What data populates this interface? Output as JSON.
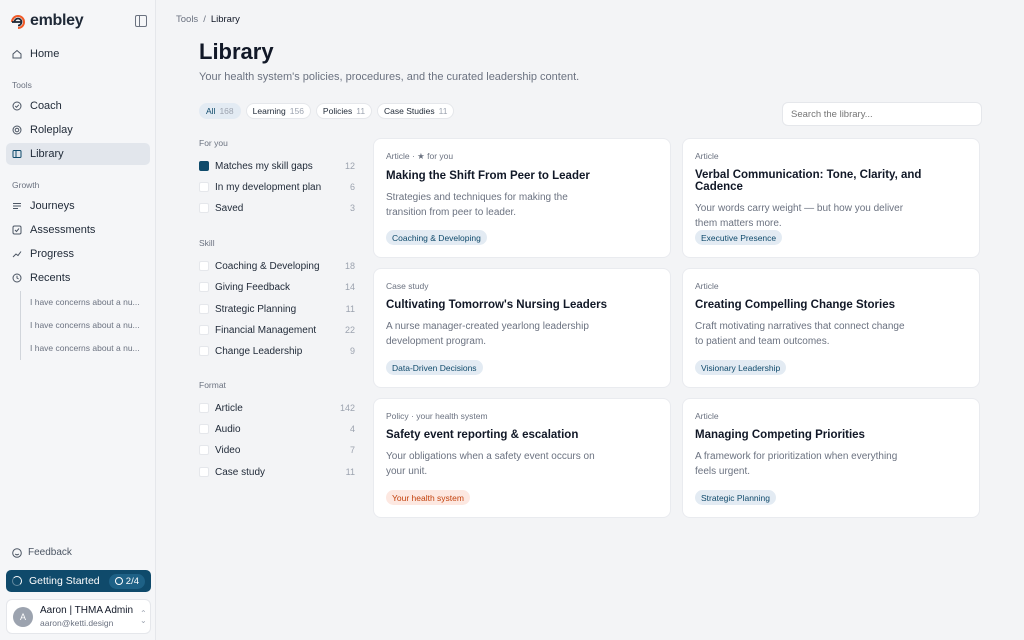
{
  "app": {
    "name": "embley"
  },
  "sidebar": {
    "home": "Home",
    "tools_label": "Tools",
    "tools": [
      {
        "label": "Coach",
        "icon": "coach-icon"
      },
      {
        "label": "Roleplay",
        "icon": "roleplay-icon"
      },
      {
        "label": "Library",
        "icon": "library-icon",
        "active": true
      }
    ],
    "growth_label": "Growth",
    "growth": [
      {
        "label": "Journeys",
        "icon": "journeys-icon"
      },
      {
        "label": "Assessments",
        "icon": "assessments-icon"
      },
      {
        "label": "Progress",
        "icon": "progress-icon"
      },
      {
        "label": "Recents",
        "icon": "recents-icon"
      }
    ],
    "recents": [
      "I have concerns about a nu...",
      "I have concerns about a nu...",
      "I have concerns about a nu..."
    ],
    "feedback": "Feedback",
    "getting_started": {
      "label": "Getting Started",
      "progress": "2/4"
    },
    "user": {
      "initial": "A",
      "name": "Aaron | THMA Admin",
      "email": "aaron@ketti.design"
    }
  },
  "breadcrumb": {
    "parent": "Tools",
    "separator": "/",
    "current": "Library"
  },
  "page": {
    "title": "Library",
    "subtitle": "Your health system's policies, procedures, and the curated leadership content."
  },
  "tabs": [
    {
      "label": "All",
      "count": "168",
      "active": true
    },
    {
      "label": "Learning",
      "count": "156"
    },
    {
      "label": "Policies",
      "count": "11"
    },
    {
      "label": "Case Studies",
      "count": "11"
    }
  ],
  "search": {
    "placeholder": "Search the library..."
  },
  "filters": {
    "for_you": {
      "label": "For you",
      "items": [
        {
          "label": "Matches my skill gaps",
          "count": "12",
          "checked": true
        },
        {
          "label": "In my development plan",
          "count": "6"
        },
        {
          "label": "Saved",
          "count": "3"
        }
      ]
    },
    "skill": {
      "label": "Skill",
      "items": [
        {
          "label": "Coaching & Developing",
          "count": "18"
        },
        {
          "label": "Giving Feedback",
          "count": "14"
        },
        {
          "label": "Strategic Planning",
          "count": "11"
        },
        {
          "label": "Financial Management",
          "count": "22"
        },
        {
          "label": "Change Leadership",
          "count": "9"
        }
      ]
    },
    "format": {
      "label": "Format",
      "items": [
        {
          "label": "Article",
          "count": "142"
        },
        {
          "label": "Audio",
          "count": "4"
        },
        {
          "label": "Video",
          "count": "7"
        },
        {
          "label": "Case study",
          "count": "11"
        }
      ]
    }
  },
  "cards": [
    {
      "meta": "Article · ★ for you",
      "title": "Making the Shift From Peer to Leader",
      "desc": "Strategies and techniques for making the transition from peer to leader.",
      "tag": "Coaching & Developing",
      "tag_style": "default"
    },
    {
      "meta": "Article",
      "title": "Verbal Communication: Tone, Clarity, and Cadence",
      "desc": "Your words carry weight — but how you deliver them matters more.",
      "tag": "Executive Presence",
      "tag_style": "default"
    },
    {
      "meta": "Case study",
      "title": "Cultivating Tomorrow's Nursing Leaders",
      "desc": "A nurse manager-created yearlong leadership development program.",
      "tag": "Data-Driven Decisions",
      "tag_style": "default"
    },
    {
      "meta": "Article",
      "title": "Creating Compelling Change Stories",
      "desc": "Craft motivating narratives that connect change to patient and team outcomes.",
      "tag": "Visionary Leadership",
      "tag_style": "default"
    },
    {
      "meta": "Policy · your health system",
      "title": "Safety event reporting & escalation",
      "desc": "Your obligations when a safety event occurs on your unit.",
      "tag": "Your health system",
      "tag_style": "warm"
    },
    {
      "meta": "Article",
      "title": "Managing Competing Priorities",
      "desc": "A framework for prioritization when everything feels urgent.",
      "tag": "Strategic Planning",
      "tag_style": "default"
    }
  ],
  "colors": {
    "accent": "#0f4a6b",
    "logo_accent": "#f05a28",
    "active_bg": "#e2e6ec"
  }
}
